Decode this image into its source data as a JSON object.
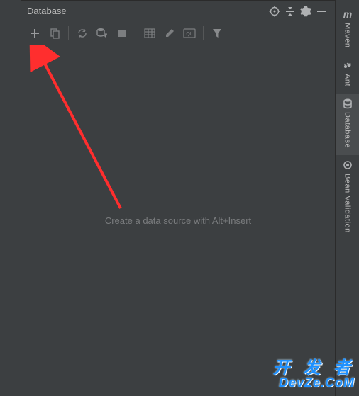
{
  "panel": {
    "title": "Database",
    "placeholder": "Create a data source with Alt+Insert"
  },
  "toolbar": {
    "add": "New",
    "copy": "Duplicate",
    "refresh": "Refresh",
    "manage": "Data Source Properties",
    "stop": "Stop",
    "table": "Table",
    "edit": "Edit",
    "ql": "QL",
    "filter": "Filter"
  },
  "headerIcons": {
    "target": "Locate",
    "split": "Collapse",
    "settings": "Settings",
    "hide": "Hide"
  },
  "sidebar": {
    "items": [
      {
        "label": "Maven",
        "active": false
      },
      {
        "label": "Ant",
        "active": false
      },
      {
        "label": "Database",
        "active": true
      },
      {
        "label": "Bean Validation",
        "active": false
      }
    ]
  },
  "watermark": {
    "chinese": "开 发 者",
    "url": "DevZe.CoM"
  },
  "colors": {
    "bg": "#3c3f41",
    "text": "#bbbbbb",
    "muted": "#7a7c7e",
    "arrow": "#ff2e2e",
    "accent": "#1e90ff"
  }
}
